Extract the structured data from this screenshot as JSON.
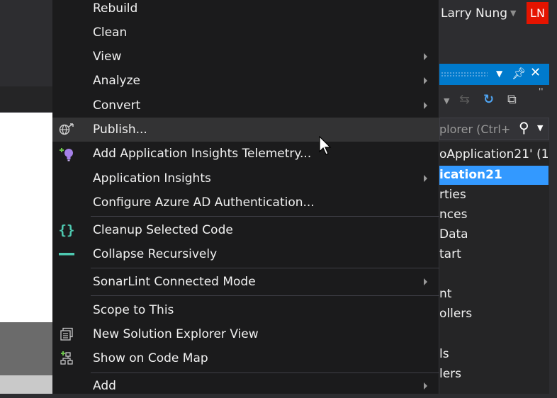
{
  "user": {
    "name": "Larry Nung",
    "initials": "LN"
  },
  "solution_explorer": {
    "search_placeholder": "plorer (Ctrl+",
    "tree": [
      {
        "text": "oApplication21' (1"
      },
      {
        "text": "ication21",
        "selected": true
      },
      {
        "text": "rties"
      },
      {
        "text": "nces"
      },
      {
        "text": "Data"
      },
      {
        "text": "tart"
      },
      {
        "text": ""
      },
      {
        "text": "nt"
      },
      {
        "text": "ollers"
      },
      {
        "text": ""
      },
      {
        "text": "ls"
      },
      {
        "text": "lers"
      }
    ]
  },
  "context_menu": {
    "items": [
      {
        "label": "Rebuild",
        "icon": null,
        "submenu": false
      },
      {
        "label": "Clean",
        "icon": null,
        "submenu": false
      },
      {
        "label": "View",
        "icon": null,
        "submenu": true
      },
      {
        "label": "Analyze",
        "icon": null,
        "submenu": true
      },
      {
        "label": "Convert",
        "icon": null,
        "submenu": true
      },
      {
        "label": "Publish...",
        "icon": "publish-globe-icon",
        "submenu": false,
        "hover": true
      },
      {
        "label": "Add Application Insights Telemetry...",
        "icon": "application-insights-icon",
        "submenu": false
      },
      {
        "label": "Application Insights",
        "icon": null,
        "submenu": true
      },
      {
        "label": "Configure Azure AD Authentication...",
        "icon": null,
        "submenu": false
      },
      {
        "label": "Cleanup Selected Code",
        "icon": "braces-icon",
        "submenu": false
      },
      {
        "label": "Collapse Recursively",
        "icon": "collapse-icon",
        "submenu": false
      },
      {
        "label": "SonarLint Connected Mode",
        "icon": null,
        "submenu": true
      },
      {
        "label": "Scope to This",
        "icon": null,
        "submenu": false
      },
      {
        "label": "New Solution Explorer View",
        "icon": "new-explorer-view-icon",
        "submenu": false
      },
      {
        "label": "Show on Code Map",
        "icon": "code-map-icon",
        "submenu": false
      },
      {
        "label": "Add",
        "icon": null,
        "submenu": true
      }
    ]
  },
  "colors": {
    "accent": "#007acc",
    "selection": "#3399ff",
    "avatar": "#e51400",
    "menu_background": "#1b1b1c",
    "menu_hover": "#333334",
    "braces_icon": "#4ec9b0"
  }
}
